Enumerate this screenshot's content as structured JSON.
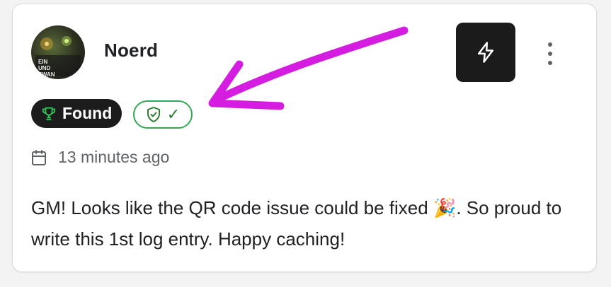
{
  "log": {
    "username": "Noerd",
    "avatar_text": "EIN UND ZWAN ZIG",
    "badges": {
      "found_label": "Found",
      "found_icon": "trophy-icon",
      "verified_icon": "shield-check-icon",
      "verified_check": "✓"
    },
    "timestamp": "13 minutes ago",
    "text": "GM! Looks like the QR code issue could be fixed 🎉. So proud to write this 1st log entry. Happy caching!"
  },
  "actions": {
    "flash_icon": "lightning-icon",
    "more_icon": "more-vertical-icon"
  },
  "colors": {
    "annotation_arrow": "#d41de0",
    "verified_green": "#34a853",
    "dark_button": "#1b1b1b"
  }
}
